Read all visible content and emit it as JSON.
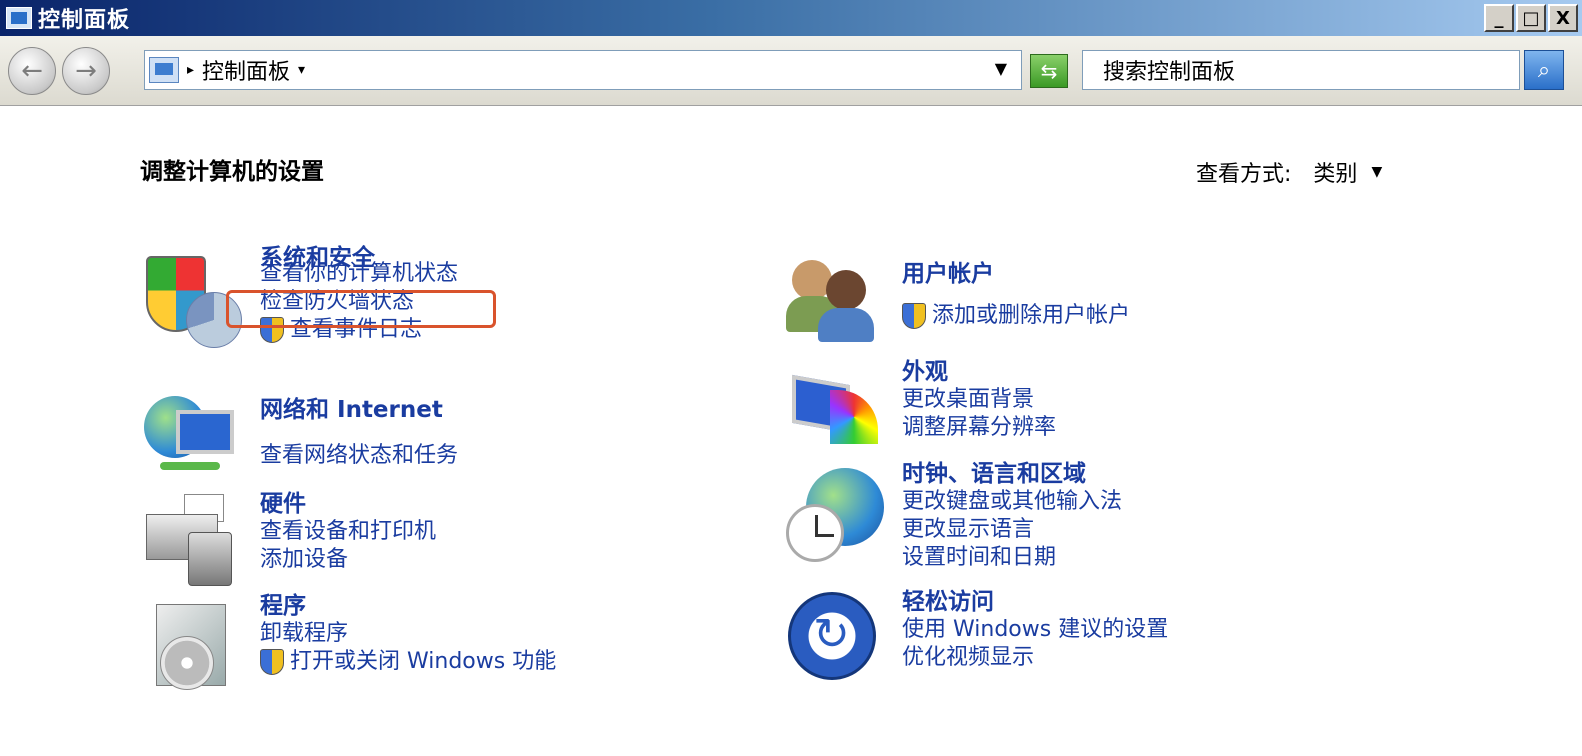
{
  "window": {
    "title": "控制面板",
    "minimize": "_",
    "maximize": "□",
    "close": "X"
  },
  "address": {
    "location": "控制面板",
    "search_placeholder": "搜索控制面板"
  },
  "main": {
    "heading": "调整计算机的设置",
    "view_by_label": "查看方式:",
    "view_by_value": "类别"
  },
  "left_categories": [
    {
      "title": "系统和安全",
      "links": [
        "查看你的计算机状态",
        "检查防火墙状态",
        "查看事件日志"
      ]
    },
    {
      "title": "网络和 Internet",
      "links": [
        "查看网络状态和任务"
      ]
    },
    {
      "title": "硬件",
      "links": [
        "查看设备和打印机",
        "添加设备"
      ]
    },
    {
      "title": "程序",
      "links": [
        "卸载程序",
        "打开或关闭 Windows 功能"
      ]
    }
  ],
  "right_categories": [
    {
      "title": "用户帐户",
      "links": [
        "添加或删除用户帐户"
      ]
    },
    {
      "title": "外观",
      "links": [
        "更改桌面背景",
        "调整屏幕分辨率"
      ]
    },
    {
      "title": "时钟、语言和区域",
      "links": [
        "更改键盘或其他输入法",
        "更改显示语言",
        "设置时间和日期"
      ]
    },
    {
      "title": "轻松访问",
      "links": [
        "使用 Windows 建议的设置",
        "优化视频显示"
      ]
    }
  ],
  "colors": {
    "link": "#1a3ca0",
    "highlight": "#d9532c"
  }
}
